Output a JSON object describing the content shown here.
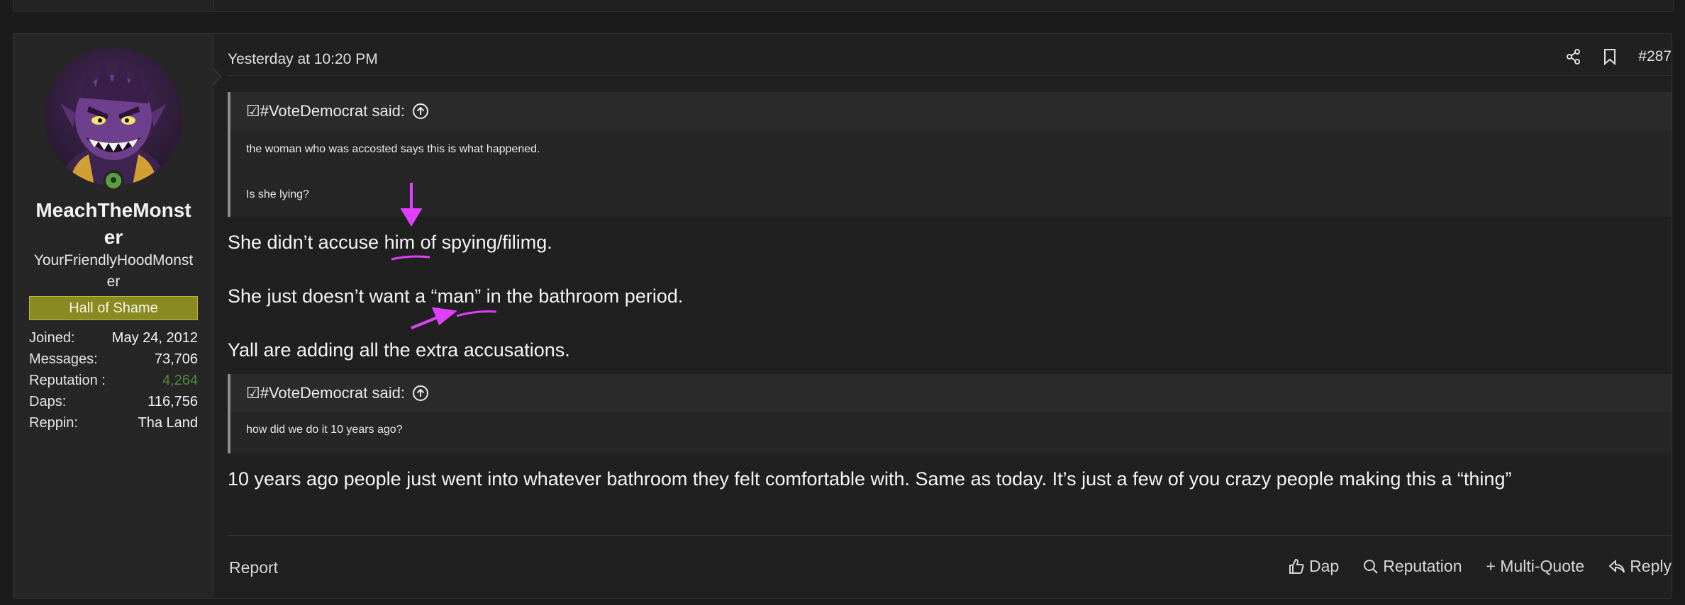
{
  "post": {
    "date": "Yesterday at 10:20 PM",
    "number": "#287",
    "user": {
      "name": "MeachTheMonster",
      "title": "YourFriendlyHoodMonster",
      "banner": "Hall of Shame",
      "stats": [
        {
          "label": "Joined:",
          "value": "May 24, 2012"
        },
        {
          "label": "Messages:",
          "value": "73,706"
        },
        {
          "label": "Reputation :",
          "value": "4,264"
        },
        {
          "label": "Daps:",
          "value": "116,756"
        },
        {
          "label": "Reppin:",
          "value": "Tha Land"
        }
      ]
    },
    "quote1": {
      "author": "☑#VoteDemocrat said:",
      "lines": [
        "the woman who was accosted says this is what happened.",
        "Is she lying?"
      ]
    },
    "body1": "She didn’t accuse him of spying/filimg.",
    "body2": "She just doesn’t want a “man” in the bathroom period.",
    "body3": "Yall are adding all the extra accusations.",
    "quote2": {
      "author": "☑#VoteDemocrat said:",
      "lines": [
        "how did we do it 10 years ago?"
      ]
    },
    "body4": "10 years ago people just went into whatever bathroom they felt comfortable with. Same as today. It’s just a few of you crazy people making this a “thing”",
    "footer": {
      "report": "Report",
      "dap": "Dap",
      "reputation": "Reputation",
      "multiquote": "+ Multi-Quote",
      "reply": "Reply"
    }
  },
  "colors": {
    "annotation": "#e040fb",
    "banner_bg": "#8a8a22",
    "reputation_value": "#4f8a3c",
    "online": "#5aa040"
  },
  "icons": [
    "share-icon",
    "bookmark-icon",
    "up-arrow-circle-icon",
    "thumbs-up-icon",
    "search-icon",
    "reply-icon",
    "online-status-icon"
  ]
}
